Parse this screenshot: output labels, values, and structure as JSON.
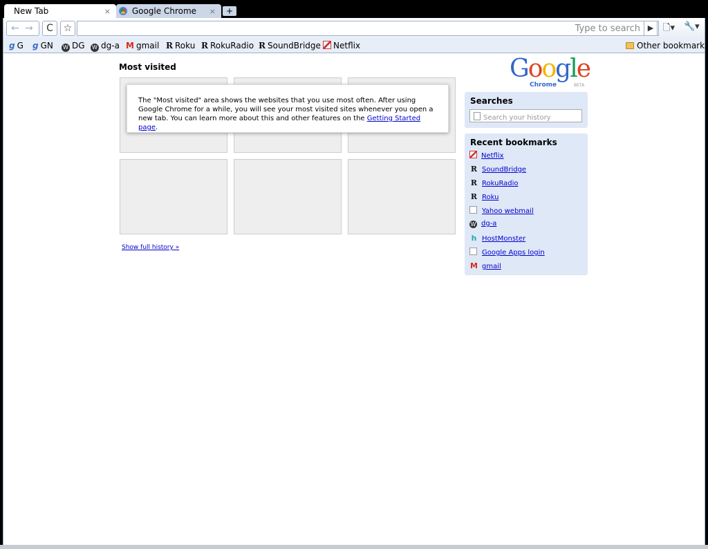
{
  "tabs": [
    {
      "title": "New Tab"
    },
    {
      "title": "Google Chrome"
    }
  ],
  "tab_close": "×",
  "new_tab": "+",
  "toolbar": {
    "back": "←",
    "forward": "→",
    "reload": "C",
    "star": "☆",
    "omnibox_placeholder": "Type to search",
    "go": "▶",
    "page_menu": "🗋▾",
    "wrench_menu": "🔧▾"
  },
  "bookmarks_bar": {
    "items": [
      {
        "label": "G",
        "icon": "google-icon"
      },
      {
        "label": "GN",
        "icon": "google-icon"
      },
      {
        "label": "DG",
        "icon": "wordpress-icon"
      },
      {
        "label": "dg-a",
        "icon": "wordpress-icon"
      },
      {
        "label": "gmail",
        "icon": "gmail-icon"
      },
      {
        "label": "Roku",
        "icon": "roku-icon"
      },
      {
        "label": "RokuRadio",
        "icon": "roku-icon"
      },
      {
        "label": "SoundBridge",
        "icon": "roku-icon"
      },
      {
        "label": "Netflix",
        "icon": "netflix-icon"
      }
    ],
    "other": "Other bookmarks"
  },
  "most_visited": {
    "title": "Most visited",
    "notice_before": "The \"Most visited\" area shows the websites that you use most often. After using Google Chrome for a while, you will see your most visited sites whenever you open a new tab. You can learn more about this and other features on the ",
    "notice_link": "Getting Started page",
    "notice_after": ".",
    "show_history": "Show full history »"
  },
  "logo": {
    "text": "Google",
    "sub": "Chrome",
    "beta": "BETA",
    "colors": [
      "#3366cc",
      "#dd4422",
      "#f4b400",
      "#3366cc",
      "#0f9d58",
      "#dd4422"
    ]
  },
  "searches": {
    "title": "Searches",
    "placeholder": "Search your history"
  },
  "recent_bookmarks": {
    "title": "Recent bookmarks",
    "items": [
      {
        "label": "Netflix",
        "icon": "netflix-icon"
      },
      {
        "label": "SoundBridge",
        "icon": "roku-icon"
      },
      {
        "label": "RokuRadio",
        "icon": "roku-icon"
      },
      {
        "label": "Roku",
        "icon": "roku-icon"
      },
      {
        "label": "Yahoo webmail",
        "icon": "page-icon"
      },
      {
        "label": "dg-a",
        "icon": "wordpress-icon"
      },
      {
        "label": "HostMonster",
        "icon": "hostmonster-icon"
      },
      {
        "label": "Google Apps login",
        "icon": "page-icon"
      },
      {
        "label": "gmail",
        "icon": "gmail-icon"
      }
    ]
  }
}
